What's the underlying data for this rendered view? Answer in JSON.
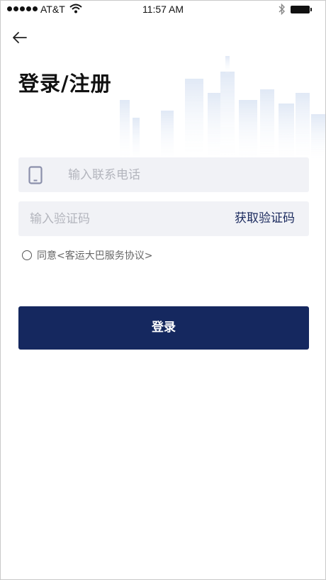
{
  "status_bar": {
    "carrier": "AT&T",
    "time": "11:57 AM"
  },
  "header": {
    "title": "登录/注册"
  },
  "form": {
    "phone_placeholder": "输入联系电话",
    "code_placeholder": "输入验证码",
    "get_code_label": "获取验证码",
    "agree_prefix": "同意",
    "agreement_link": "<客运大巴服务协议>",
    "login_label": "登录"
  },
  "colors": {
    "primary": "#15285f",
    "field_background": "#f1f2f6",
    "placeholder": "#b3b5bd"
  }
}
